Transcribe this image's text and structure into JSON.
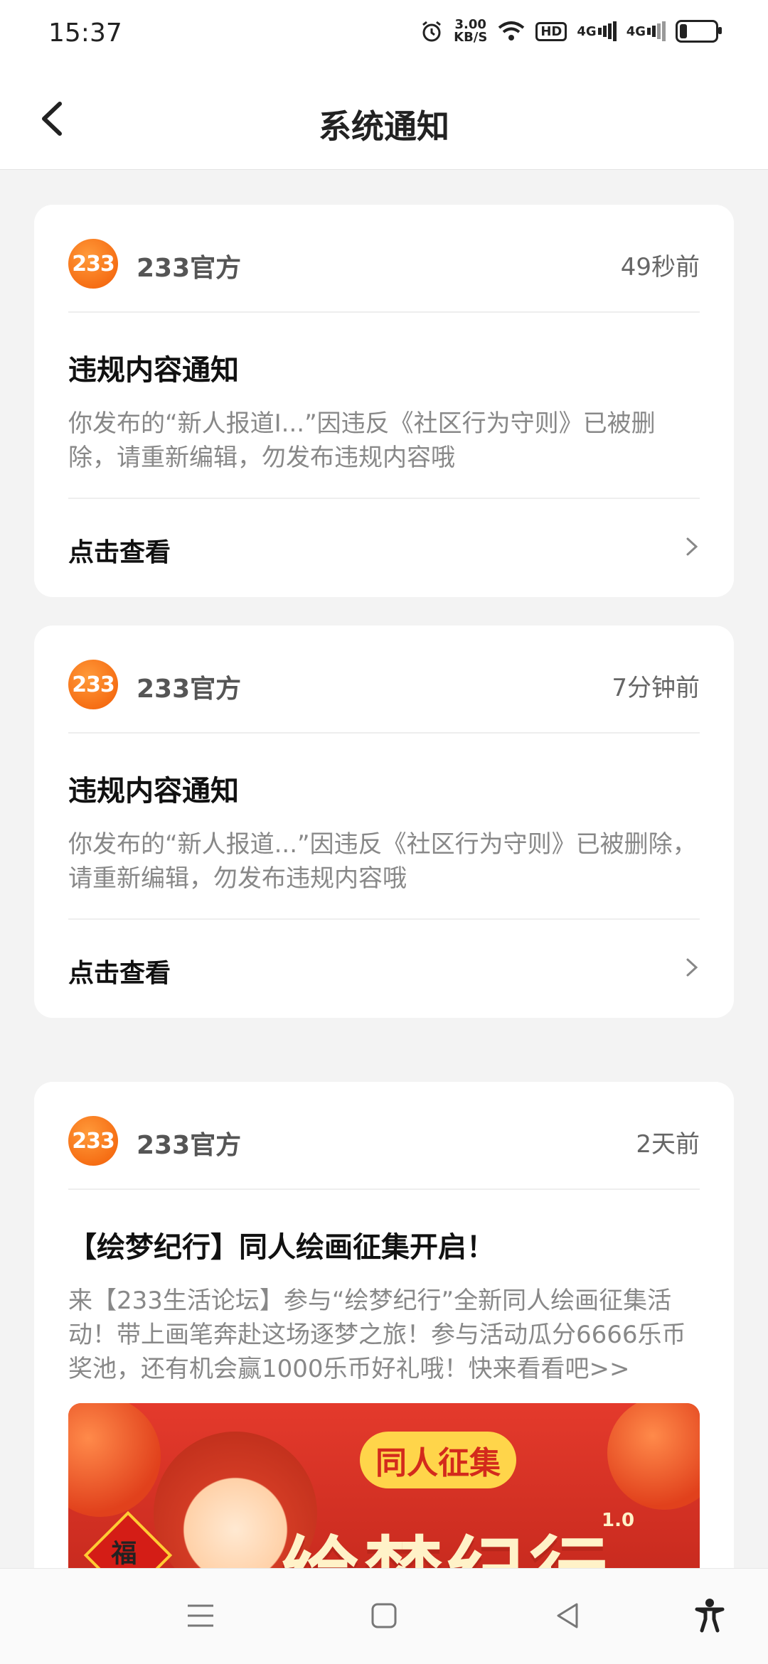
{
  "status_bar": {
    "time": "15:37",
    "speed_value": "3.00",
    "speed_unit": "KB/S",
    "hd_label": "HD",
    "net1": "4G",
    "net2": "4G",
    "icons": [
      "alarm-icon",
      "wifi-icon",
      "hd-icon",
      "signal-icon",
      "signal-icon",
      "battery-icon"
    ]
  },
  "header": {
    "title": "系统通知",
    "back_icon": "back-arrow-icon"
  },
  "notifications": [
    {
      "avatar_text": "233",
      "sender": "233官方",
      "time": "49秒前",
      "title": "违规内容通知",
      "text": "你发布的“新人报道I...”因违反《社区行为守则》已被删除，请重新编辑，勿发布违规内容哦",
      "action": "点击查看"
    },
    {
      "avatar_text": "233",
      "sender": "233官方",
      "time": "7分钟前",
      "title": "违规内容通知",
      "text": "你发布的“新人报道...”因违反《社区行为守则》已被删除，请重新编辑，勿发布违规内容哦",
      "action": "点击查看"
    },
    {
      "avatar_text": "233",
      "sender": "233官方",
      "time": "2天前",
      "title": "【绘梦纪行】同人绘画征集开启！",
      "text": "来【233生活论坛】参与“绘梦纪行”全新同人绘画征集活动！带上画笔奔赴这场逐梦之旅！参与活动瓜分6666乐币奖池，还有机会赢1000乐币好礼哦！快来看看吧>>",
      "banner": {
        "tag": "同人征集",
        "title": "绘梦纪行",
        "version": "1.0",
        "fu": "福"
      }
    }
  ],
  "nav_bar": {
    "icons": [
      "menu-icon",
      "home-icon",
      "back-icon",
      "accessibility-icon"
    ]
  },
  "colors": {
    "accent": "#f25c05",
    "background": "#f3f3f3",
    "banner_red": "#d32a1c"
  }
}
